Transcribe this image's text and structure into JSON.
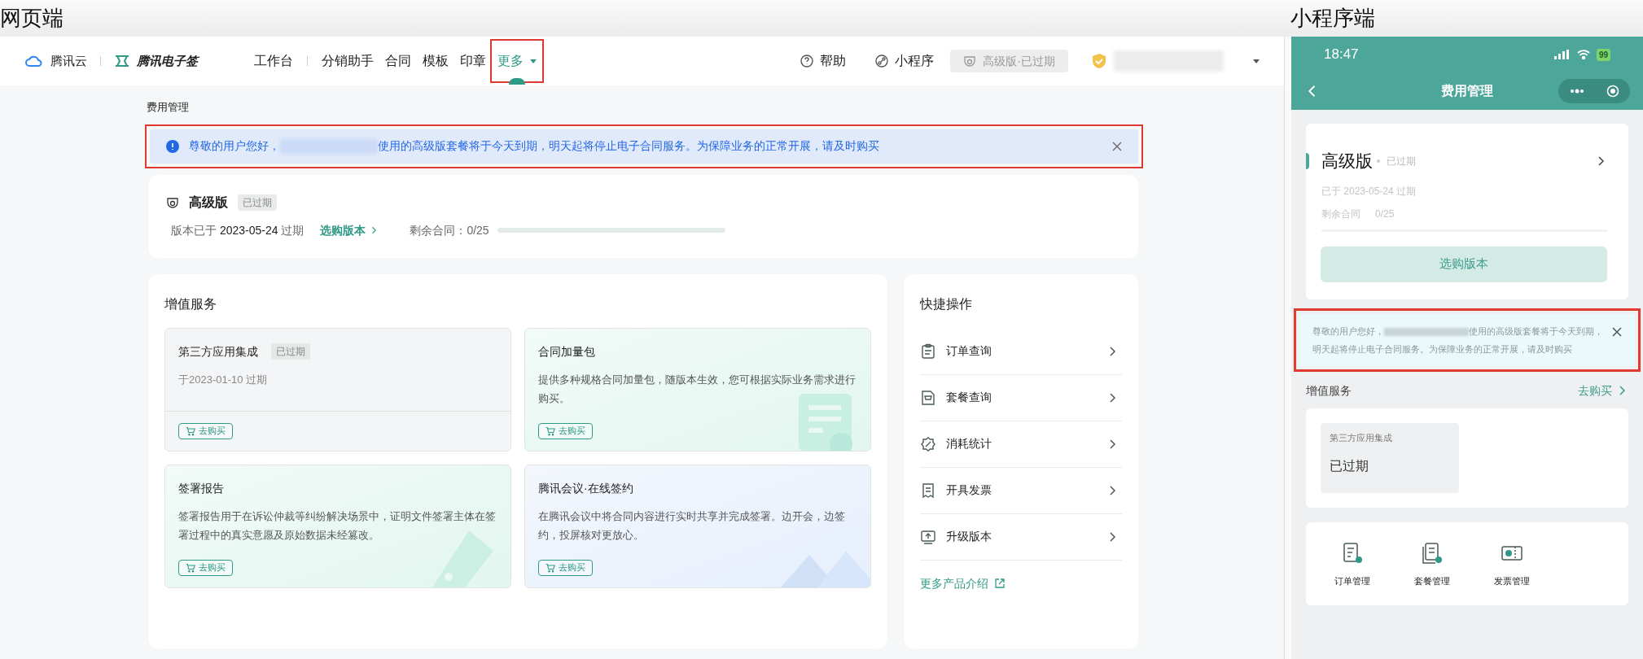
{
  "web_label": "网页端",
  "mini_label": "小程序端",
  "web": {
    "brand": {
      "cloud": "腾讯云",
      "product": "腾讯电子签"
    },
    "nav": [
      {
        "label": "工作台",
        "selected": false,
        "highlighted": false,
        "dropdown": false
      },
      {
        "label": "分销助手",
        "selected": false,
        "highlighted": false,
        "dropdown": false
      },
      {
        "label": "合同",
        "selected": false,
        "highlighted": false,
        "dropdown": false
      },
      {
        "label": "模板",
        "selected": false,
        "highlighted": false,
        "dropdown": false
      },
      {
        "label": "印章",
        "selected": false,
        "highlighted": false,
        "dropdown": false
      },
      {
        "label": "更多",
        "selected": true,
        "highlighted": true,
        "dropdown": true
      }
    ],
    "help": "帮助",
    "miniprogram": "小程序",
    "plan_badge": "高级版·已过期",
    "page_title": "费用管理",
    "banner": {
      "greeting": "尊敬的用户您好，",
      "message": "使用的高级版套餐将于今天到期，明天起将停止电子合同服务。为保障业务的正常开展，请及时购买",
      "highlighted": true
    },
    "plan": {
      "name": "高级版",
      "status": "已过期",
      "expiry_label": "版本已于",
      "expiry_date": "2023-05-24",
      "expiry_suffix": "过期",
      "buy_link": "选购版本",
      "remaining": "剩余合同：0/25",
      "level": 0
    },
    "services": {
      "title": "增值服务",
      "items": [
        {
          "kind": "expired",
          "title": "第三方应用集成",
          "tag": "已过期",
          "text": "于2023-01-10 过期",
          "button": "去购买"
        },
        {
          "kind": "package",
          "title": "合同加量包",
          "text": "提供多种规格合同加量包，随版本生效，您可根据实际业务需求进行购买。",
          "button": "去购买"
        },
        {
          "kind": "report",
          "title": "签署报告",
          "text": "签署报告用于在诉讼仲裁等纠纷解决场景中，证明文件签署主体在签署过程中的真实意愿及原始数据未经篡改。",
          "button": "去购买"
        },
        {
          "kind": "meeting",
          "title": "腾讯会议·在线签约",
          "text": "在腾讯会议中将合同内容进行实时共享并完成签署。边开会，边签约，投屏核对更放心。",
          "button": "去购买"
        }
      ]
    },
    "quick": {
      "title": "快捷操作",
      "items": [
        {
          "label": "订单查询",
          "kind": "orders"
        },
        {
          "label": "套餐查询",
          "kind": "plans"
        },
        {
          "label": "消耗统计",
          "kind": "usage"
        },
        {
          "label": "开具发票",
          "kind": "invoice"
        },
        {
          "label": "升级版本",
          "kind": "upgrade"
        }
      ],
      "more": "更多产品介绍"
    }
  },
  "mini": {
    "time": "18:47",
    "battery": "99",
    "title": "费用管理",
    "plan": {
      "name": "高级版",
      "status": "已过期",
      "expiry": "已于 2023-05-24 过期",
      "remaining_label": "剩余合同",
      "remaining": "0/25",
      "level": 0,
      "button": "选购版本"
    },
    "notice": {
      "greeting": "尊敬的用户您好，",
      "message": "使用的高级版套餐将于今天到期，明天起将停止电子合同服务。为保障业务的正常开展，请及时购买",
      "highlighted": true
    },
    "services": {
      "title": "增值服务",
      "link": "去购买",
      "tile": {
        "title": "第三方应用集成",
        "status": "已过期"
      }
    },
    "shortcuts": [
      {
        "label": "订单管理",
        "kind": "orders"
      },
      {
        "label": "套餐管理",
        "kind": "plans"
      },
      {
        "label": "发票管理",
        "kind": "invoice"
      }
    ]
  }
}
